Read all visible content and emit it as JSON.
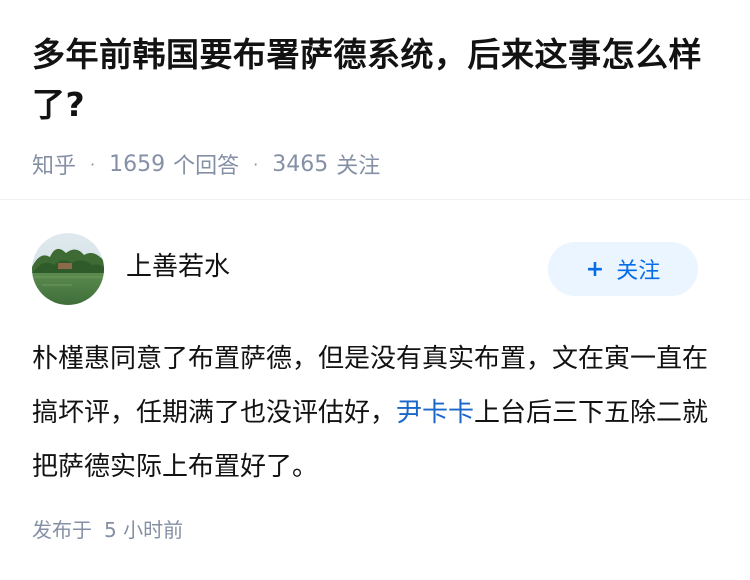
{
  "question": {
    "title": "多年前韩国要布署萨德系统，后来这事怎么样了?",
    "source": "知乎",
    "answer_count": "1659",
    "answer_label": "个回答",
    "follow_count": "3465",
    "follow_label": "关注"
  },
  "answer": {
    "author_name": "上善若水",
    "follow_button": "关注",
    "content_part1": "朴槿惠同意了布置萨德，但是没有真实布置，文在寅一直在搞坏评，任期满了也没评估好，",
    "content_link": "尹卡卡",
    "content_part2": "上台后三下五除二就把萨德实际上布置好了。",
    "publish_label": "发布于",
    "publish_time": "5 小时前"
  },
  "icons": {
    "follow_plus": "plus-icon"
  },
  "colors": {
    "link": "#1a66c9",
    "follow_bg": "#ebf5ff",
    "follow_text": "#056de8",
    "meta": "#8590a6"
  }
}
